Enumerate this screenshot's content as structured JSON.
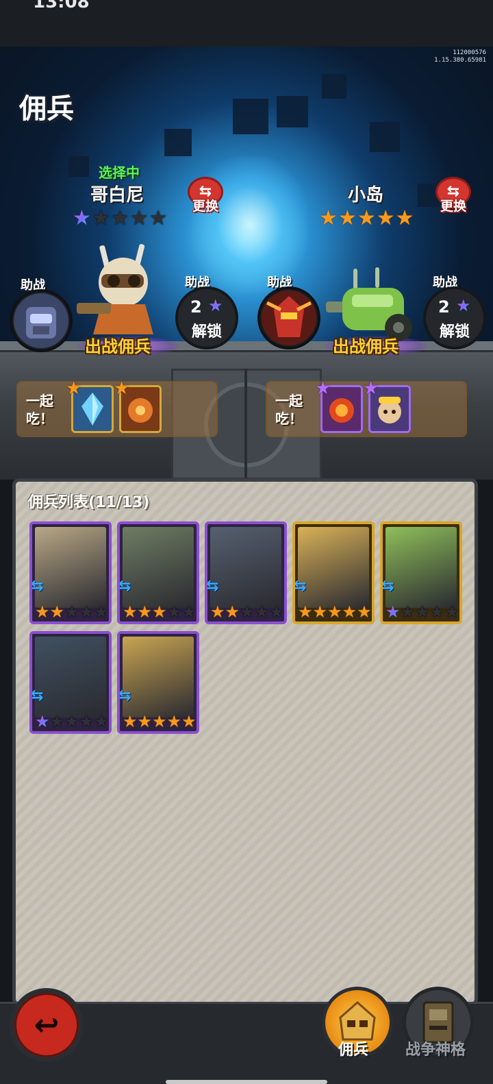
{
  "status_bar": {
    "time": "13:08"
  },
  "version": {
    "line1": "112000576",
    "line2": "1.15.380.65981"
  },
  "page_title": "佣兵",
  "slots": [
    {
      "status": "选择中",
      "name": "哥白尼",
      "swap_label": "更换",
      "swap_icon": "swap-arrows-icon",
      "stars": [
        "rainbow",
        "empty",
        "empty",
        "empty",
        "empty"
      ],
      "deploy_label": "出战佣兵",
      "assist_label": "助战",
      "assist_lock_label": "助战",
      "lock_count": "2",
      "lock_text": "解锁",
      "eat_label": "一起吃！",
      "food": [
        {
          "name": "blue-crystal",
          "star": "gold"
        },
        {
          "name": "orange-gear",
          "star": "gold"
        }
      ]
    },
    {
      "status": "",
      "name": "小岛",
      "swap_label": "更换",
      "swap_icon": "swap-arrows-icon",
      "stars": [
        "gold",
        "gold",
        "gold",
        "gold",
        "gold"
      ],
      "deploy_label": "出战佣兵",
      "assist_label": "助战",
      "assist_lock_label": "助战",
      "lock_count": "2",
      "lock_text": "解锁",
      "eat_label": "一起吃！",
      "food": [
        {
          "name": "fire-orb",
          "star": "purple"
        },
        {
          "name": "monkey-king",
          "star": "purple"
        }
      ]
    }
  ],
  "list": {
    "title": "佣兵列表(11/13)",
    "mercs": [
      {
        "frame": "purple",
        "art": "#b8a886",
        "stars": [
          "gold",
          "gold",
          "empty",
          "empty",
          "empty"
        ]
      },
      {
        "frame": "purple",
        "art": "#6f7d63",
        "stars": [
          "gold",
          "gold",
          "gold",
          "empty",
          "empty"
        ]
      },
      {
        "frame": "purple",
        "art": "#566070",
        "stars": [
          "gold",
          "gold",
          "empty",
          "empty",
          "empty"
        ]
      },
      {
        "frame": "gold",
        "art": "#d9b158",
        "stars": [
          "gold",
          "gold",
          "gold",
          "gold",
          "gold"
        ]
      },
      {
        "frame": "gold",
        "art": "#8fbf5a",
        "stars": [
          "rainbow",
          "empty",
          "empty",
          "empty",
          "empty"
        ]
      },
      {
        "frame": "purple",
        "art": "#3f5160",
        "stars": [
          "rainbow",
          "empty",
          "empty",
          "empty",
          "empty"
        ]
      },
      {
        "frame": "purple",
        "art": "#c9a552",
        "stars": [
          "gold",
          "gold",
          "gold",
          "gold",
          "gold"
        ]
      }
    ]
  },
  "nav": {
    "back_icon": "back-arrow-icon",
    "tabs": [
      {
        "label": "佣兵",
        "active": true
      },
      {
        "label": "战争神格",
        "active": false
      }
    ]
  },
  "colors": {
    "accent_gold": "#f69a1e",
    "select_green": "#5ff05a",
    "swap_red": "#d3362f"
  }
}
